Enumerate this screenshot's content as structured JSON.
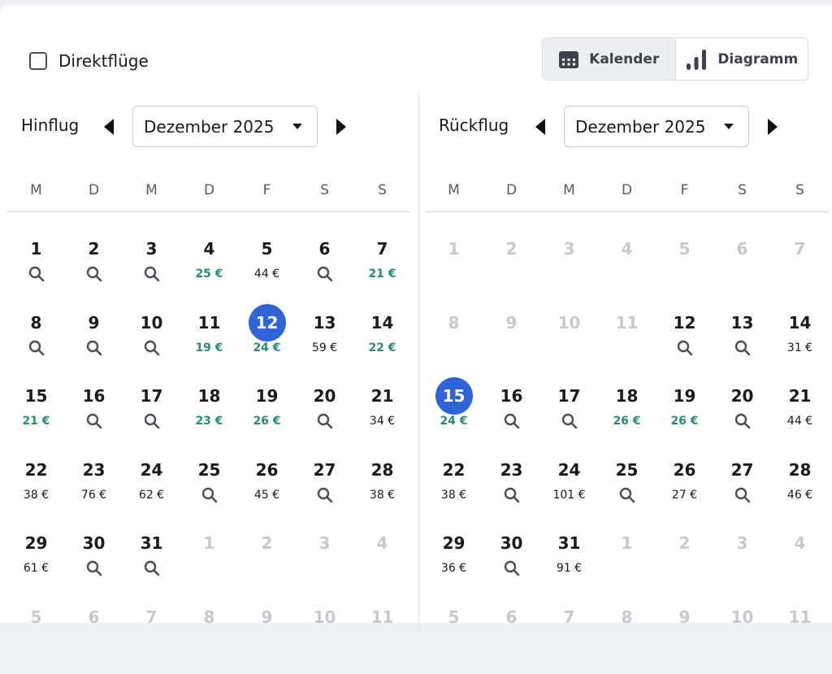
{
  "filter": {
    "direct_label": "Direktflüge",
    "direct_checked": false
  },
  "view_toggle": {
    "calendar_label": "Kalender",
    "chart_label": "Diagramm",
    "active": "calendar"
  },
  "outbound": {
    "label": "Hinflug",
    "month": "Dezember 2025",
    "weekdays": [
      "M",
      "D",
      "M",
      "D",
      "F",
      "S",
      "S"
    ],
    "weeks": [
      [
        {
          "d": "1",
          "p": "search"
        },
        {
          "d": "2",
          "p": "search"
        },
        {
          "d": "3",
          "p": "search"
        },
        {
          "d": "4",
          "p": "25 €",
          "c": true
        },
        {
          "d": "5",
          "p": "44 €"
        },
        {
          "d": "6",
          "p": "search"
        },
        {
          "d": "7",
          "p": "21 €",
          "c": true
        }
      ],
      [
        {
          "d": "8",
          "p": "search"
        },
        {
          "d": "9",
          "p": "search"
        },
        {
          "d": "10",
          "p": "search"
        },
        {
          "d": "11",
          "p": "19 €",
          "c": true
        },
        {
          "d": "12",
          "p": "24 €",
          "c": true,
          "sel": true
        },
        {
          "d": "13",
          "p": "59 €"
        },
        {
          "d": "14",
          "p": "22 €",
          "c": true
        }
      ],
      [
        {
          "d": "15",
          "p": "21 €",
          "c": true
        },
        {
          "d": "16",
          "p": "search"
        },
        {
          "d": "17",
          "p": "search"
        },
        {
          "d": "18",
          "p": "23 €",
          "c": true
        },
        {
          "d": "19",
          "p": "26 €",
          "c": true
        },
        {
          "d": "20",
          "p": "search"
        },
        {
          "d": "21",
          "p": "34 €"
        }
      ],
      [
        {
          "d": "22",
          "p": "38 €"
        },
        {
          "d": "23",
          "p": "76 €"
        },
        {
          "d": "24",
          "p": "62 €"
        },
        {
          "d": "25",
          "p": "search"
        },
        {
          "d": "26",
          "p": "45 €"
        },
        {
          "d": "27",
          "p": "search"
        },
        {
          "d": "28",
          "p": "38 €"
        }
      ],
      [
        {
          "d": "29",
          "p": "61 €"
        },
        {
          "d": "30",
          "p": "search"
        },
        {
          "d": "31",
          "p": "search"
        },
        {
          "d": "1",
          "m": true
        },
        {
          "d": "2",
          "m": true
        },
        {
          "d": "3",
          "m": true
        },
        {
          "d": "4",
          "m": true
        }
      ],
      [
        {
          "d": "5",
          "m": true
        },
        {
          "d": "6",
          "m": true
        },
        {
          "d": "7",
          "m": true
        },
        {
          "d": "8",
          "m": true
        },
        {
          "d": "9",
          "m": true
        },
        {
          "d": "10",
          "m": true
        },
        {
          "d": "11",
          "m": true
        }
      ]
    ]
  },
  "return": {
    "label": "Rückflug",
    "month": "Dezember 2025",
    "weekdays": [
      "M",
      "D",
      "M",
      "D",
      "F",
      "S",
      "S"
    ],
    "weeks": [
      [
        {
          "d": "1",
          "m": true
        },
        {
          "d": "2",
          "m": true
        },
        {
          "d": "3",
          "m": true
        },
        {
          "d": "4",
          "m": true
        },
        {
          "d": "5",
          "m": true
        },
        {
          "d": "6",
          "m": true
        },
        {
          "d": "7",
          "m": true
        }
      ],
      [
        {
          "d": "8",
          "m": true
        },
        {
          "d": "9",
          "m": true
        },
        {
          "d": "10",
          "m": true
        },
        {
          "d": "11",
          "m": true
        },
        {
          "d": "12",
          "p": "search"
        },
        {
          "d": "13",
          "p": "search"
        },
        {
          "d": "14",
          "p": "31 €"
        }
      ],
      [
        {
          "d": "15",
          "p": "24 €",
          "c": true,
          "sel": true
        },
        {
          "d": "16",
          "p": "search"
        },
        {
          "d": "17",
          "p": "search"
        },
        {
          "d": "18",
          "p": "26 €",
          "c": true
        },
        {
          "d": "19",
          "p": "26 €",
          "c": true
        },
        {
          "d": "20",
          "p": "search"
        },
        {
          "d": "21",
          "p": "44 €"
        }
      ],
      [
        {
          "d": "22",
          "p": "38 €"
        },
        {
          "d": "23",
          "p": "search"
        },
        {
          "d": "24",
          "p": "101 €"
        },
        {
          "d": "25",
          "p": "search"
        },
        {
          "d": "26",
          "p": "27 €"
        },
        {
          "d": "27",
          "p": "search"
        },
        {
          "d": "28",
          "p": "46 €"
        }
      ],
      [
        {
          "d": "29",
          "p": "36 €"
        },
        {
          "d": "30",
          "p": "search"
        },
        {
          "d": "31",
          "p": "91 €"
        },
        {
          "d": "1",
          "m": true
        },
        {
          "d": "2",
          "m": true
        },
        {
          "d": "3",
          "m": true
        },
        {
          "d": "4",
          "m": true
        }
      ],
      [
        {
          "d": "5",
          "m": true
        },
        {
          "d": "6",
          "m": true
        },
        {
          "d": "7",
          "m": true
        },
        {
          "d": "8",
          "m": true
        },
        {
          "d": "9",
          "m": true
        },
        {
          "d": "10",
          "m": true
        },
        {
          "d": "11",
          "m": true
        }
      ]
    ]
  },
  "colors": {
    "selected": "#2f63d8",
    "cheap_price": "#2a8a7e",
    "muted_day": "#c6c9ce"
  }
}
